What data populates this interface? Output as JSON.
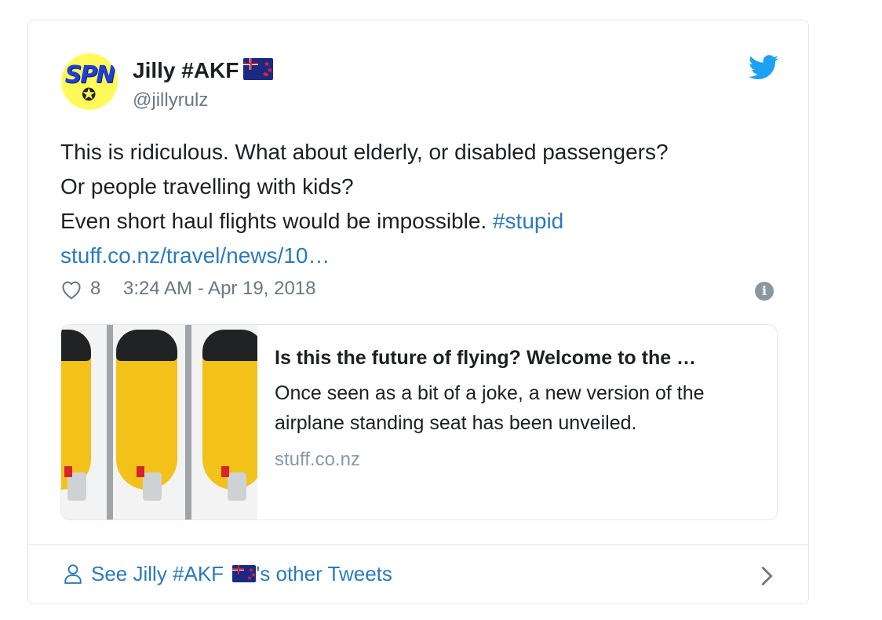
{
  "tweet": {
    "author": {
      "name": "Jilly #AKF",
      "handle": "@jillyrulz",
      "avatar_text": "SPN",
      "flag_icon": "new-zealand-flag-icon"
    },
    "text_line1": "This is ridiculous. What about elderly, or disabled passengers?",
    "text_line2": "Or people travelling with kids?",
    "text_line3": "Even short haul flights would be impossible.",
    "hashtag": "#stupid",
    "link": "stuff.co.nz/travel/news/10…",
    "likes": "8",
    "timestamp": "3:24 AM - Apr 19, 2018",
    "link_card": {
      "title": "Is this the future of flying? Welcome to the …",
      "description": "Once seen as a bit of a joke, a new version of the airplane standing seat has been unveiled.",
      "domain": "stuff.co.nz"
    },
    "footer": {
      "prefix": "See Jilly #AKF",
      "suffix": "'s other Tweets"
    }
  },
  "colors": {
    "link": "#2b7bb9",
    "muted": "#697882",
    "border": "#e1e8ed",
    "twitter_blue": "#1da1f2"
  }
}
